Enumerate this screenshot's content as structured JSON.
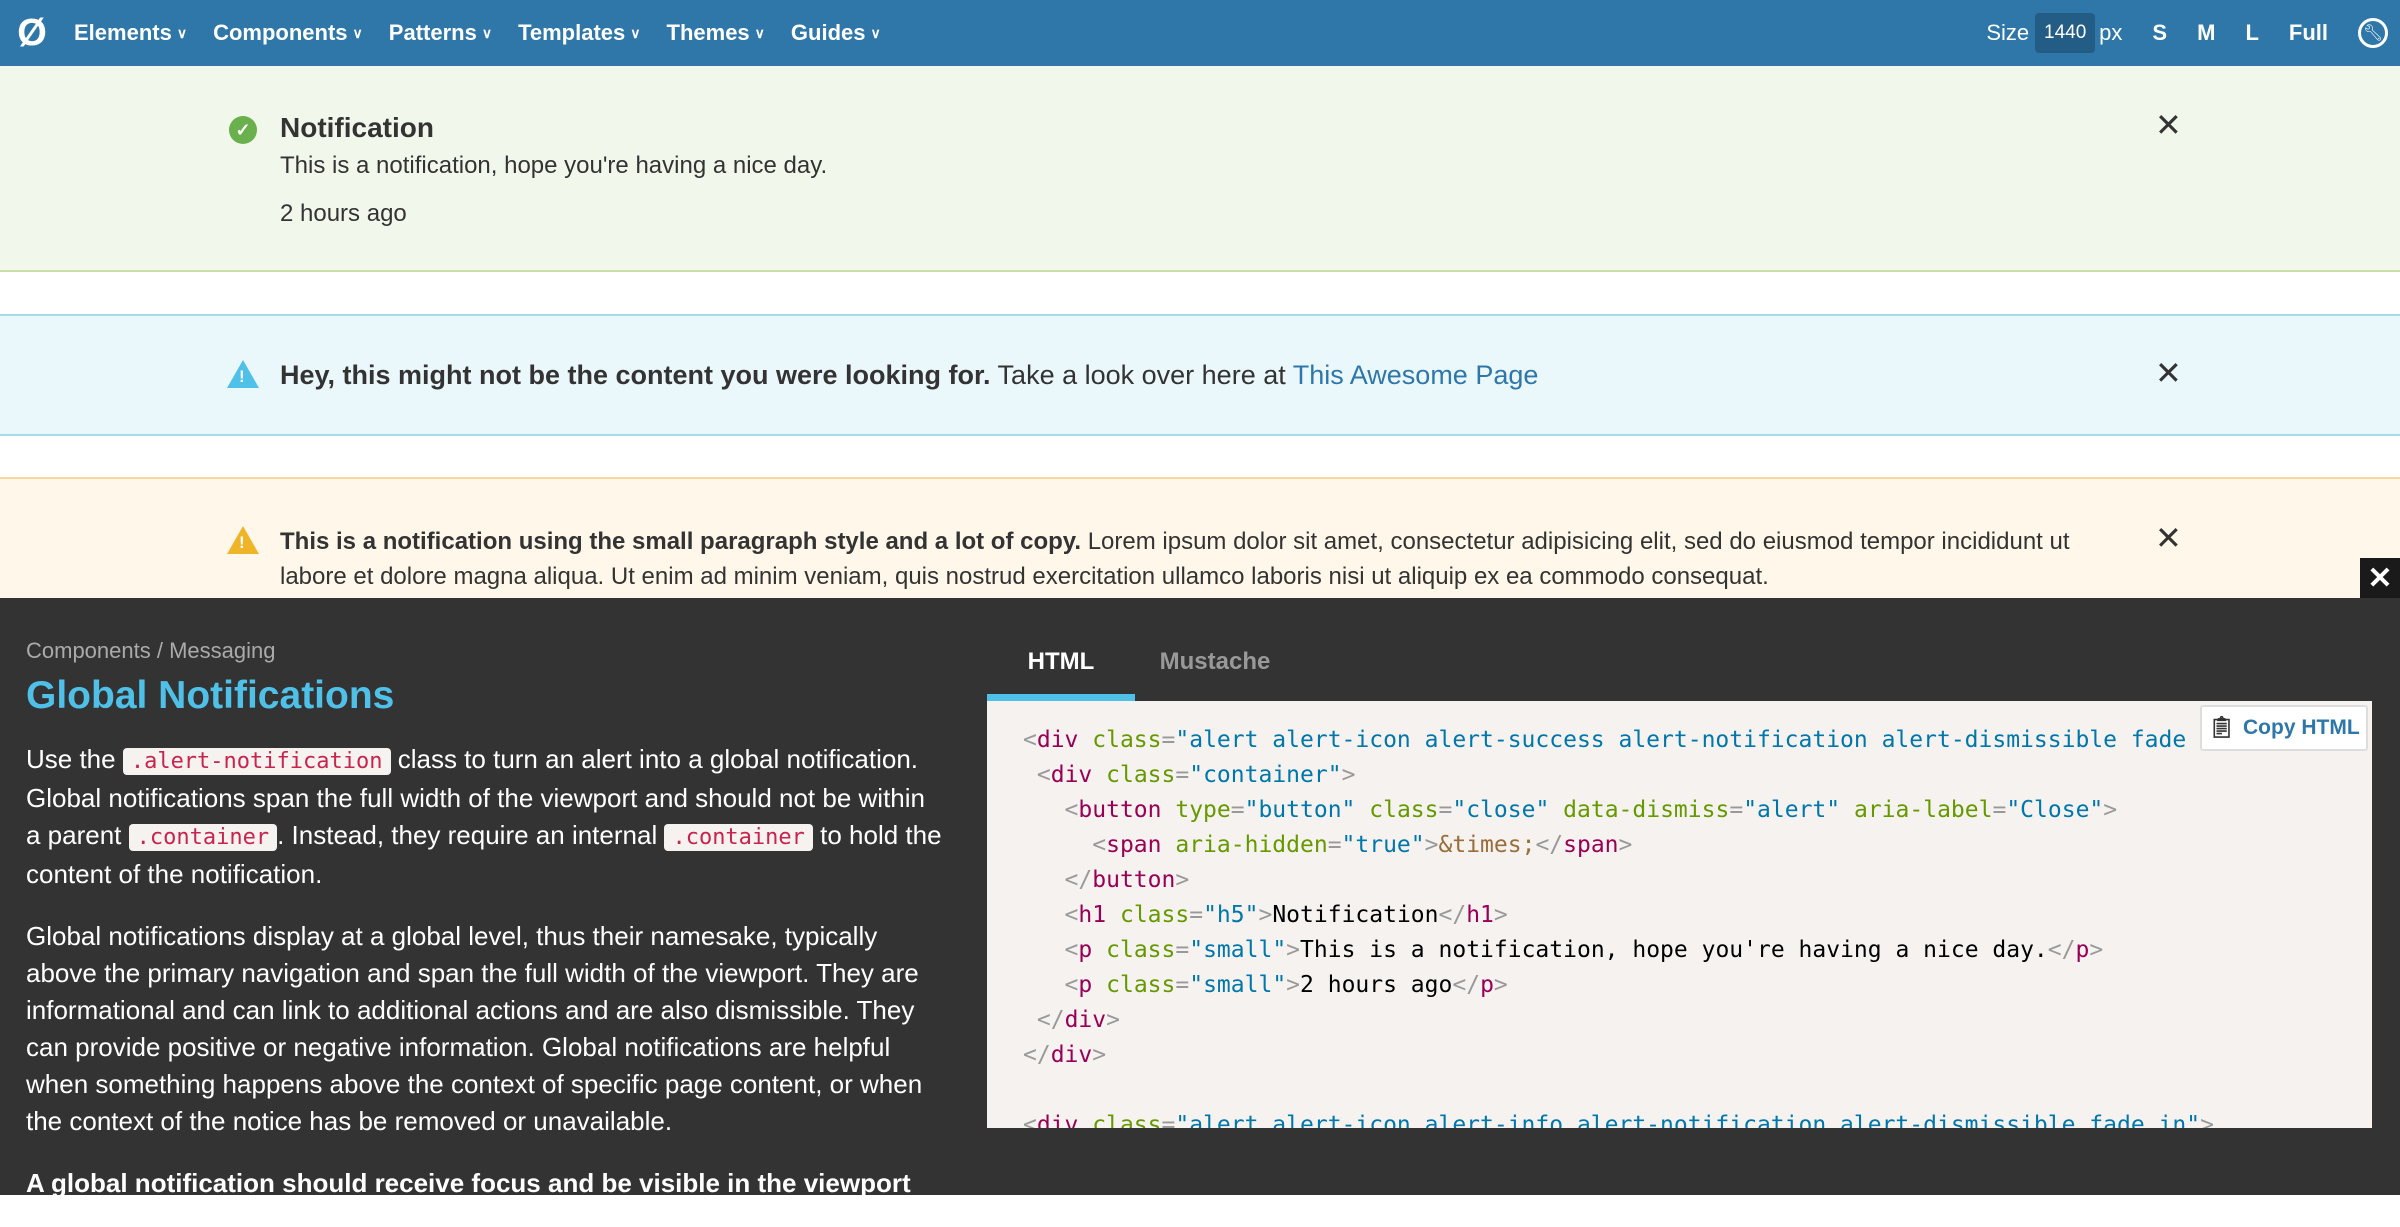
{
  "nav": {
    "items": [
      {
        "label": "Elements"
      },
      {
        "label": "Components"
      },
      {
        "label": "Patterns"
      },
      {
        "label": "Templates"
      },
      {
        "label": "Themes"
      },
      {
        "label": "Guides"
      }
    ],
    "size_label": "Size",
    "size_value": "1440",
    "size_unit": "px",
    "sizes": [
      "S",
      "M",
      "L",
      "Full"
    ]
  },
  "alerts": {
    "success": {
      "title": "Notification",
      "text": "This is a notification, hope you're having a nice day.",
      "time": "2 hours ago"
    },
    "info": {
      "bold": "Hey, this might not be the content you were looking for.",
      "text": " Take a look over here at ",
      "link": "This Awesome Page"
    },
    "warning": {
      "bold": "This is a notification using the small paragraph style and a lot of copy.",
      "text": " Lorem ipsum dolor sit amet, consectetur adipisicing elit, sed do eiusmod tempor incididunt ut labore et dolore magna aliqua. Ut enim ad minim veniam, quis nostrud exercitation ullamco laboris nisi ut aliquip ex ea commodo consequat."
    }
  },
  "panel": {
    "breadcrumb": "Components / Messaging",
    "title": "Global Notifications",
    "p1": [
      "Use the ",
      ".alert-notification",
      " class to turn an alert into a global notification. Global notifications span the full width of the viewport and should not be within a parent ",
      ".container",
      ". Instead, they require an internal ",
      ".container",
      " to hold the content of the notification."
    ],
    "p2": "Global notifications display at a global level, thus their namesake, typically above the primary navigation and span the full width of the viewport. They are informational and can link to additional actions and are also dismissible. They can provide positive or negative information. Global notifications are helpful when something happens above the context of specific page content, or when the context of the notice has be removed or unavailable.",
    "p3": "A global notification should receive focus and be visible in the viewport",
    "tabs": [
      "HTML",
      "Mustache"
    ],
    "copy_label": "Copy HTML"
  },
  "colors": {
    "nav": "#2e77a8",
    "accent": "#4fc0e8",
    "success": "#6ab04c",
    "info": "#4fc0e8",
    "warning": "#f0b429",
    "panel": "#333333"
  }
}
